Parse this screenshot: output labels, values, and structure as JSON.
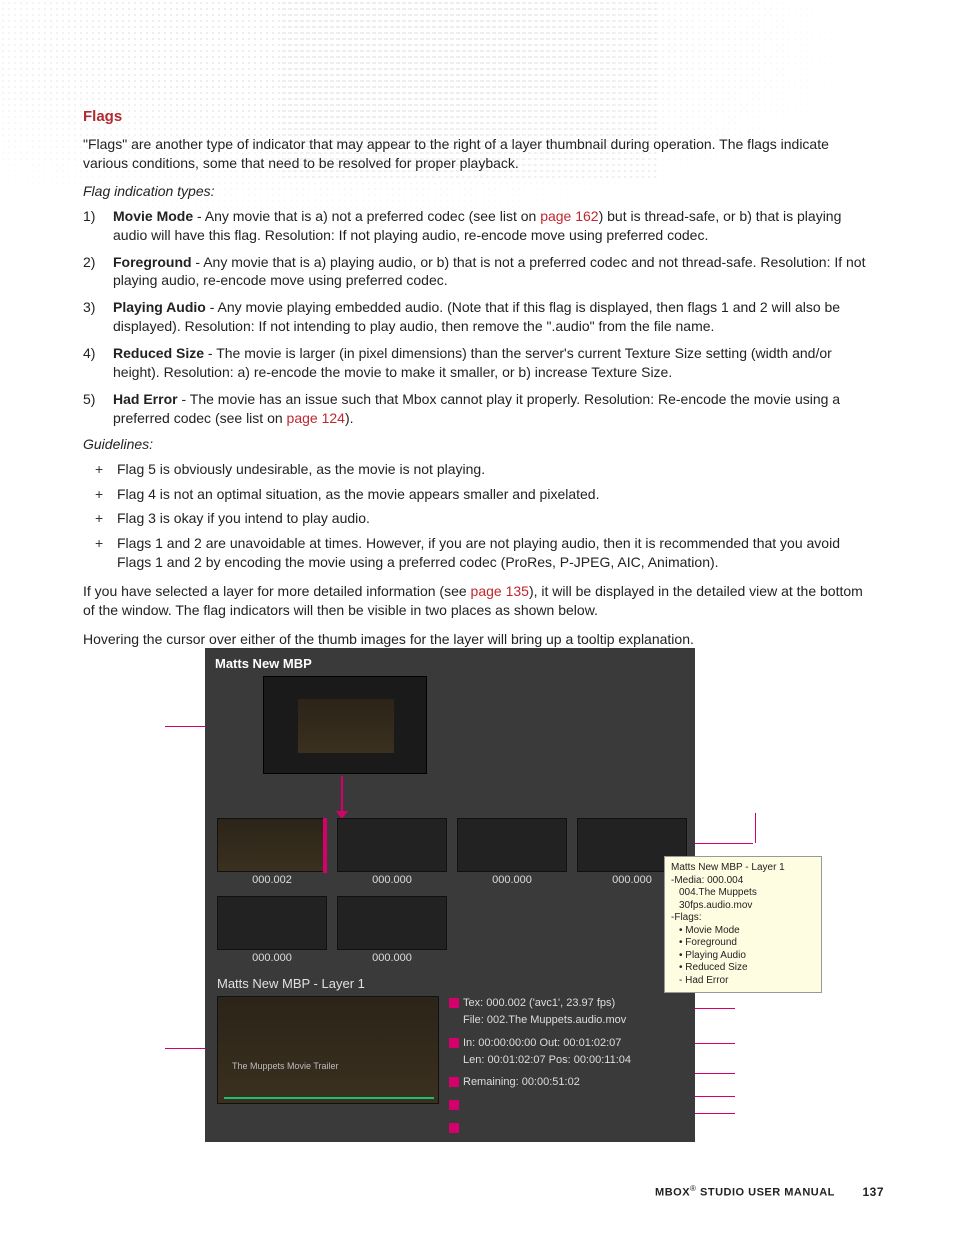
{
  "heading": "Flags",
  "intro": "\"Flags\" are another type of indicator that may appear to the right of a layer thumbnail during operation. The flags indicate various conditions, some that need to be resolved for proper playback.",
  "sub1": "Flag indication types:",
  "items": [
    {
      "n": "1)",
      "lead": "Movie Mode",
      "rest_a": " - Any movie that is a) not a preferred codec (see list on ",
      "link": "page 162",
      "rest_b": ") but is thread-safe, or b) that is playing audio will have this flag. Resolution: If not playing audio, re-encode move using preferred codec."
    },
    {
      "n": "2)",
      "lead": "Foreground",
      "rest_a": " - Any movie that is a) playing audio, or b) that is not a preferred codec and not thread-safe. Resolution: If not playing audio, re-encode move using preferred codec.",
      "link": "",
      "rest_b": ""
    },
    {
      "n": "3)",
      "lead": "Playing Audio",
      "rest_a": " - Any movie playing embedded audio. (Note that if this flag is displayed, then flags 1 and 2 will also be displayed). Resolution: If not intending to play audio, then remove the \".audio\" from the file name.",
      "link": "",
      "rest_b": ""
    },
    {
      "n": "4)",
      "lead": "Reduced Size",
      "rest_a": " - The movie is larger (in pixel dimensions) than the server's current Texture Size setting (width and/or height). Resolution: a) re-encode the movie to make it smaller, or b) increase Texture Size.",
      "link": "",
      "rest_b": ""
    },
    {
      "n": "5)",
      "lead": "Had Error",
      "rest_a": " - The movie has an issue such that Mbox cannot play it properly. Resolution: Re-encode the movie using a preferred codec (see list on ",
      "link": "page 124",
      "rest_b": ")."
    }
  ],
  "sub2": "Guidelines:",
  "plus": [
    "Flag 5 is obviously undesirable, as the movie is not playing.",
    "Flag 4 is not an optimal situation, as the movie appears smaller and pixelated.",
    "Flag 3 is okay if you intend to play audio.",
    "Flags 1 and 2 are unavoidable at times. However, if you are not playing audio, then it is recommended that you avoid Flags 1 and 2 by encoding the movie using a preferred codec (ProRes, P-JPEG, AIC, Animation)."
  ],
  "p2a": "If you have selected a layer for more detailed information (see ",
  "p2link": "page 135",
  "p2b": "), it will be displayed in the detailed view at the bottom of the window. The flag indicators will then be visible in two places as shown below.",
  "p3": "Hovering the cursor over either of the thumb images for the layer will bring up a tooltip explanation.",
  "shot": {
    "title": "Matts New MBP",
    "caps_r1": [
      "000.002",
      "000.000",
      "000.000",
      "000.000"
    ],
    "caps_r2": [
      "000.000",
      "000.000"
    ],
    "detail_title": "Matts New MBP - Layer 1",
    "detail_sub": "The Muppets Movie Trailer",
    "tex": "Tex: 000.002 ('avc1', 23.97 fps)",
    "file": "File: 002.The Muppets.audio.mov",
    "inout": "In:   00:00:00:00   Out: 00:01:02:07",
    "lenpos": "Len: 00:01:02:07   Pos: 00:00:11:04",
    "remain": "Remaining: 00:00:51:02"
  },
  "tooltip": {
    "l1": "Matts New MBP - Layer 1",
    "l2": "-Media: 000.004",
    "l3": "004.The Muppets 30fps.audio.mov",
    "l4": "-Flags:",
    "l5": "• Movie Mode",
    "l6": "• Foreground",
    "l7": "• Playing Audio",
    "l8": "• Reduced Size",
    "l9": "- Had Error"
  },
  "footer": {
    "label": "MBOX",
    "label2": " STUDIO USER MANUAL",
    "page": "137"
  }
}
